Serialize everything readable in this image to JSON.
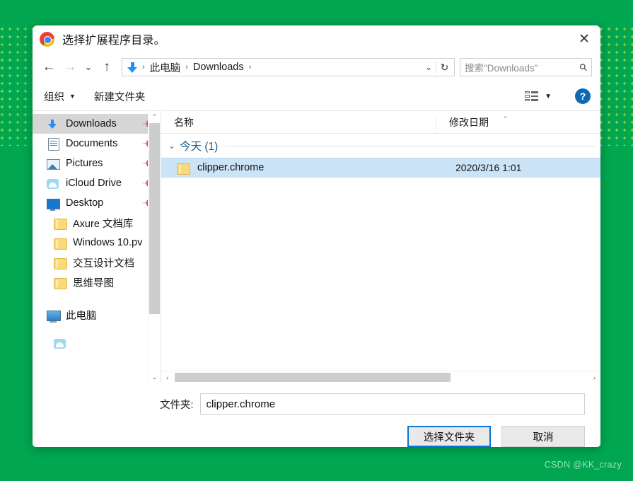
{
  "window": {
    "title": "选择扩展程序目录。",
    "logo_icon": "chrome-logo-icon",
    "close_label": "✕"
  },
  "nav": {
    "back": "←",
    "forward": "→",
    "recent": "⌄",
    "up": "↑",
    "address_icon": "downloads-arrow-icon",
    "breadcrumbs": [
      "此电脑",
      "Downloads"
    ],
    "separator": "›",
    "dropdown": "⌄",
    "refresh": "↻",
    "search_placeholder": "搜索\"Downloads\"",
    "search_icon": "search-icon"
  },
  "toolbar": {
    "organize_label": "组织",
    "organize_caret": "▼",
    "new_folder_label": "新建文件夹",
    "view_icon": "view-options-icon",
    "view_caret": "▼",
    "help_icon": "help-icon",
    "help_label": "?"
  },
  "sidebar": {
    "items": [
      {
        "label": "Downloads",
        "icon": "download-icon",
        "pinned": true,
        "selected": true
      },
      {
        "label": "Documents",
        "icon": "document-icon",
        "pinned": true,
        "selected": false
      },
      {
        "label": "Pictures",
        "icon": "picture-icon",
        "pinned": true,
        "selected": false
      },
      {
        "label": "iCloud Drive",
        "icon": "cloud-icon",
        "pinned": true,
        "selected": false
      },
      {
        "label": "Desktop",
        "icon": "desktop-icon",
        "pinned": true,
        "selected": false
      },
      {
        "label": "Axure 文档库",
        "icon": "folder-icon",
        "pinned": false,
        "selected": false
      },
      {
        "label": "Windows 10.pv",
        "icon": "folder-icon",
        "pinned": false,
        "selected": false
      },
      {
        "label": "交互设计文档",
        "icon": "folder-icon",
        "pinned": false,
        "selected": false
      },
      {
        "label": "思维导图",
        "icon": "folder-icon",
        "pinned": false,
        "selected": false
      },
      {
        "label": "此电脑",
        "icon": "this-pc-icon",
        "pinned": false,
        "selected": false
      }
    ],
    "scroll_up": "⌃",
    "scroll_down": "⌄"
  },
  "filelist": {
    "columns": {
      "name": "名称",
      "date": "修改日期"
    },
    "header_caret": "⌄",
    "group": {
      "caret": "⌄",
      "label": "今天 (1)"
    },
    "rows": [
      {
        "icon": "folder-icon",
        "name": "clipper.chrome",
        "date": "2020/3/16 1:01",
        "selected": true
      }
    ],
    "hscroll_left": "‹",
    "hscroll_right": "›"
  },
  "footer": {
    "folder_label": "文件夹:",
    "folder_value": "clipper.chrome",
    "select_button": "选择文件夹",
    "cancel_button": "取消"
  },
  "watermark": "CSDN @KK_crazy",
  "colors": {
    "background": "#00a650",
    "selection": "#cce4f7",
    "primary_border": "#0a74d0",
    "link_blue": "#1b5c8a"
  }
}
